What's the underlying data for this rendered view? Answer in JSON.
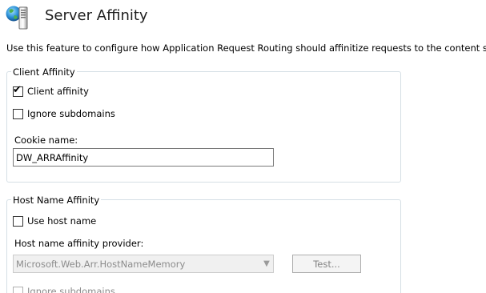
{
  "header": {
    "title": "Server Affinity",
    "icon": "server-globe-icon"
  },
  "description": "Use this feature to configure how Application Request Routing should affinitize requests to the content servers.",
  "client_affinity": {
    "legend": "Client Affinity",
    "client_affinity_checkbox": {
      "label": "Client affinity",
      "checked": true
    },
    "ignore_subdomains_checkbox": {
      "label": "Ignore subdomains",
      "checked": false
    },
    "cookie_name_label": "Cookie name:",
    "cookie_name_value": "DW_ARRAffinity"
  },
  "host_name_affinity": {
    "legend": "Host Name Affinity",
    "use_host_name_checkbox": {
      "label": "Use host name",
      "checked": false
    },
    "provider_label": "Host name affinity provider:",
    "provider_value": "Microsoft.Web.Arr.HostNameMemory",
    "test_button_label": "Test...",
    "ignore_subdomains_checkbox": {
      "label": "Ignore subdomains",
      "checked": false
    }
  },
  "colors": {
    "group_border": "#d5dfe5",
    "disabled_text": "#8c8c8c"
  }
}
